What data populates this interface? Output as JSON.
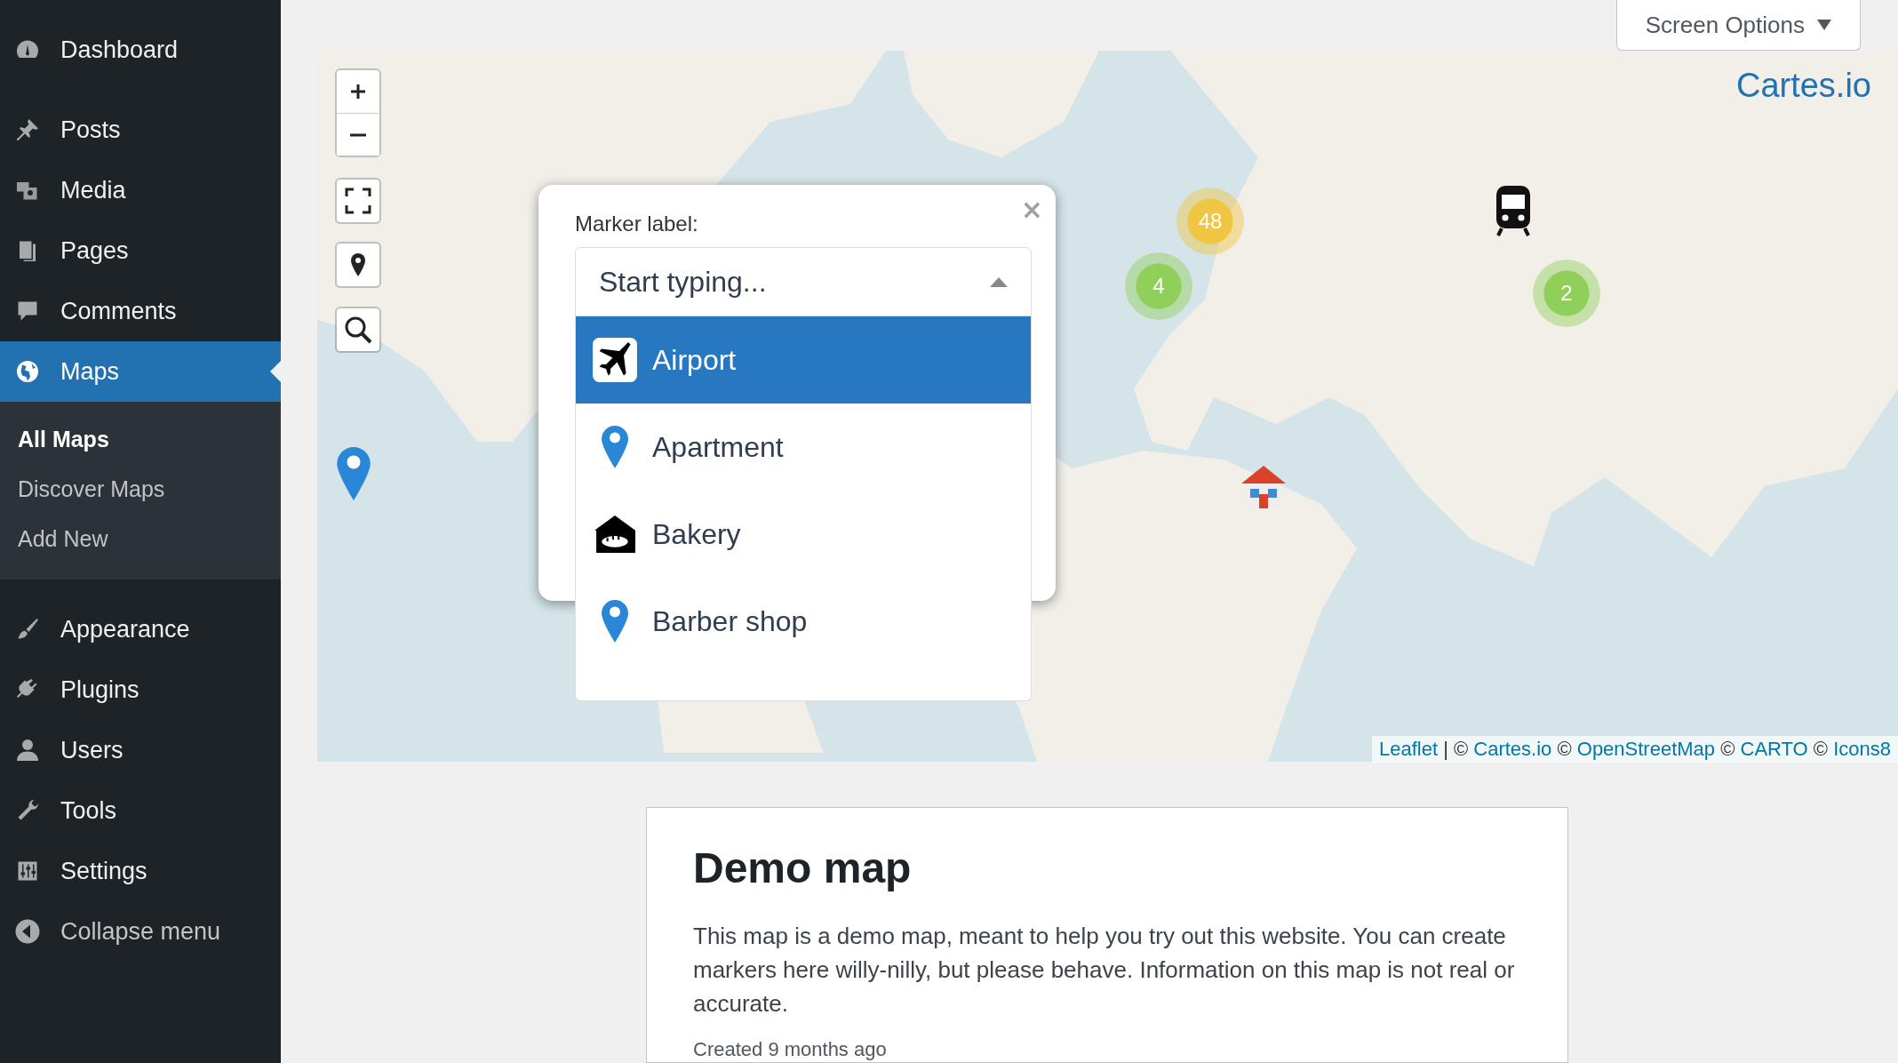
{
  "sidebar": {
    "groups": [
      {
        "items": [
          {
            "label": "Dashboard",
            "kind": "dashboard",
            "selected": false
          }
        ]
      },
      {
        "items": [
          {
            "label": "Posts",
            "kind": "posts",
            "selected": false
          },
          {
            "label": "Media",
            "kind": "media",
            "selected": false
          },
          {
            "label": "Pages",
            "kind": "pages",
            "selected": false
          },
          {
            "label": "Comments",
            "kind": "comments",
            "selected": false
          },
          {
            "label": "Maps",
            "kind": "maps",
            "selected": true,
            "submenu": [
              {
                "label": "All Maps",
                "selected": true
              },
              {
                "label": "Discover Maps",
                "selected": false
              },
              {
                "label": "Add New",
                "selected": false
              }
            ]
          }
        ]
      },
      {
        "items": [
          {
            "label": "Appearance",
            "kind": "appearance",
            "selected": false
          },
          {
            "label": "Plugins",
            "kind": "plugins",
            "selected": false
          },
          {
            "label": "Users",
            "kind": "users",
            "selected": false
          },
          {
            "label": "Tools",
            "kind": "tools",
            "selected": false
          },
          {
            "label": "Settings",
            "kind": "settings",
            "selected": false
          }
        ]
      }
    ],
    "collapse": "Collapse menu"
  },
  "screen_options": "Screen Options",
  "map": {
    "logo": "Cartes.io",
    "clusters": [
      {
        "count": "48",
        "color": "#f0c542"
      },
      {
        "count": "4",
        "color": "#8fcf5a"
      },
      {
        "count": "2",
        "color": "#8fcf5a"
      }
    ],
    "popup": {
      "close": "×",
      "label": "Marker label:",
      "placeholder": "Start typing...",
      "options": [
        {
          "label": "Airport",
          "kind": "airport",
          "selected": true
        },
        {
          "label": "Apartment",
          "kind": "pin",
          "selected": false
        },
        {
          "label": "Bakery",
          "kind": "bakery",
          "selected": false
        },
        {
          "label": "Barber shop",
          "kind": "pin",
          "selected": false
        }
      ]
    },
    "attribution": {
      "links": [
        "Leaflet",
        "Cartes.io",
        "OpenStreetMap",
        "CARTO",
        "Icons8"
      ],
      "separators": [
        " | © ",
        " © ",
        " © ",
        " © "
      ]
    }
  },
  "card": {
    "title": "Demo map",
    "description": "This map is a demo map, meant to help you try out this website. You can create markers here willy-nilly, but please behave. Information on this map is not real or accurate.",
    "created": "Created 9 months ago"
  }
}
